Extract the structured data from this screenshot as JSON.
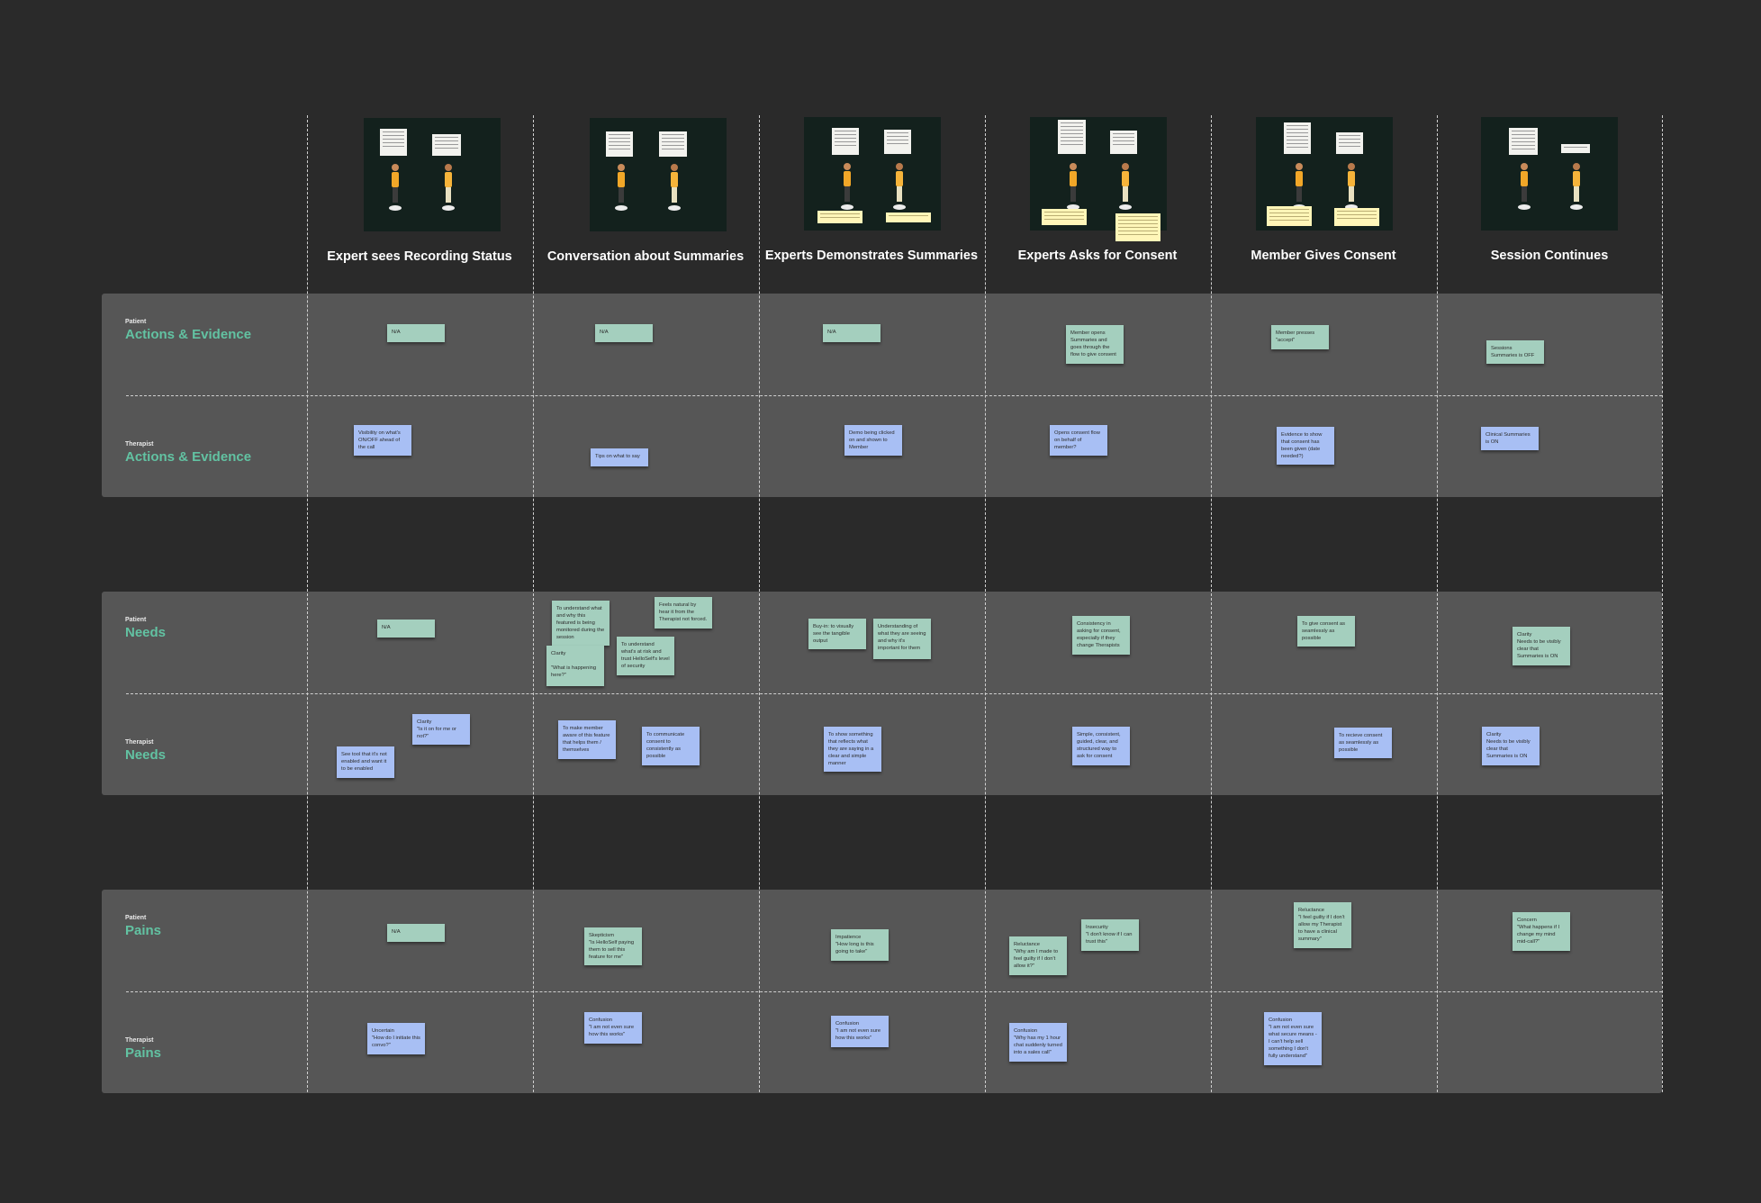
{
  "colors": {
    "background": "#2a2a2a",
    "band": "#565656",
    "label": "#62c2a2",
    "patient_sticky": "#a4cfbe",
    "therapist_sticky": "#a8bff4"
  },
  "columns": [
    "Expert sees Recording Status",
    "Conversation about Summaries",
    "Experts Demonstrates Summaries",
    "Experts Asks for Consent",
    "Member Gives Consent",
    "Session Continues"
  ],
  "rows": {
    "patient_actions": {
      "role": "Patient",
      "title": "Actions & Evidence"
    },
    "therapist_actions": {
      "role": "Therapist",
      "title": "Actions & Evidence"
    },
    "patient_needs": {
      "role": "Patient",
      "title": "Needs"
    },
    "therapist_needs": {
      "role": "Therapist",
      "title": "Needs"
    },
    "patient_pains": {
      "role": "Patient",
      "title": "Pains"
    },
    "therapist_pains": {
      "role": "Therapist",
      "title": "Pains"
    }
  },
  "notes": {
    "pa1": "N/A",
    "pa2": "N/A",
    "pa3": "N/A",
    "pa4": "Member opens Summaries and goes through the flow to give consent",
    "pa5": "Member presses \"accept\"",
    "pa6": "Sessions Summaries is OFF",
    "ta1": "Visibility on what's ON/OFF ahead of the call",
    "ta2": "Tips on what to say",
    "ta3": "Demo being clicked on and shown to Member",
    "ta4": "Opens consent flow on behalf of member?",
    "ta5": "Evidence to show that consent has been given (date needed?)",
    "ta6": "Clinical Summaries is ON",
    "pn1": "N/A",
    "pn2a": "To understand what and why this featured is being monitored during the session",
    "pn2b": "Feels natural by hear it from the Therapist not forced.",
    "pn2c": "Clarity\n\n\"What is happening here?\"",
    "pn2d": "To understand what's at risk and trust HelloSelf's level of security",
    "pn3a": "Buy-in: to visually see the tangible output",
    "pn3b": "Understanding of what they are seeing and why it's important for them",
    "pn4": "Consistency in asking for consent, especially if they change Therapists",
    "pn5": "To give consent as seamlessly as possible",
    "pn6": "Clarity\nNeeds to be visibly clear that Summaries is ON",
    "tn1a": "Clarity\n\"Is it on for me or not?\"",
    "tn1b": "See tool that it's not enabled and want it to be enabled",
    "tn2a": "To make member aware of this feature that helps them / themselves",
    "tn2b": "To communicate consent to consistently as possible",
    "tn3": "To show something that reflects what they are saying in a clear and simple manner",
    "tn4": "Simple, consistent, guided, clear, and structured way to ask for consent",
    "tn5": "To recieve consent as seamlessly as possible",
    "tn6": "Clarity\nNeeds to be visibly clear that Summaries is ON",
    "pp1": "N/A",
    "pp2": "Skepticism\n\"Is HelloSelf paying them to sell this feature for me\"",
    "pp3": "Impatience\n\"How long is this going to take\"",
    "pp4a": "Reluctance\n\"Why am I made to feel guilty if I don't allow it?\"",
    "pp4b": "Insecurity\n\"I don't know if I can trust this\"",
    "pp5": "Reluctance\n\"I feel guilty if I don't allow my Therapist to have a clinical summary\"",
    "pp6": "Concern\n\"What happens if I change my mind mid-call?\"",
    "tp1": "Uncertain\n\"How do I initiate this convo?\"",
    "tp2": "Confusion\n\"I am not even sure how this works\"",
    "tp3": "Confusion\n\"I am not even sure how this works\"",
    "tp4": "Confusion\n\"Why has my 1 hour chat suddenly turned into a sales call\"",
    "tp5": "Confusion\n\"I am not even sure what secure means - I can't help sell something I don't fully understand\""
  }
}
